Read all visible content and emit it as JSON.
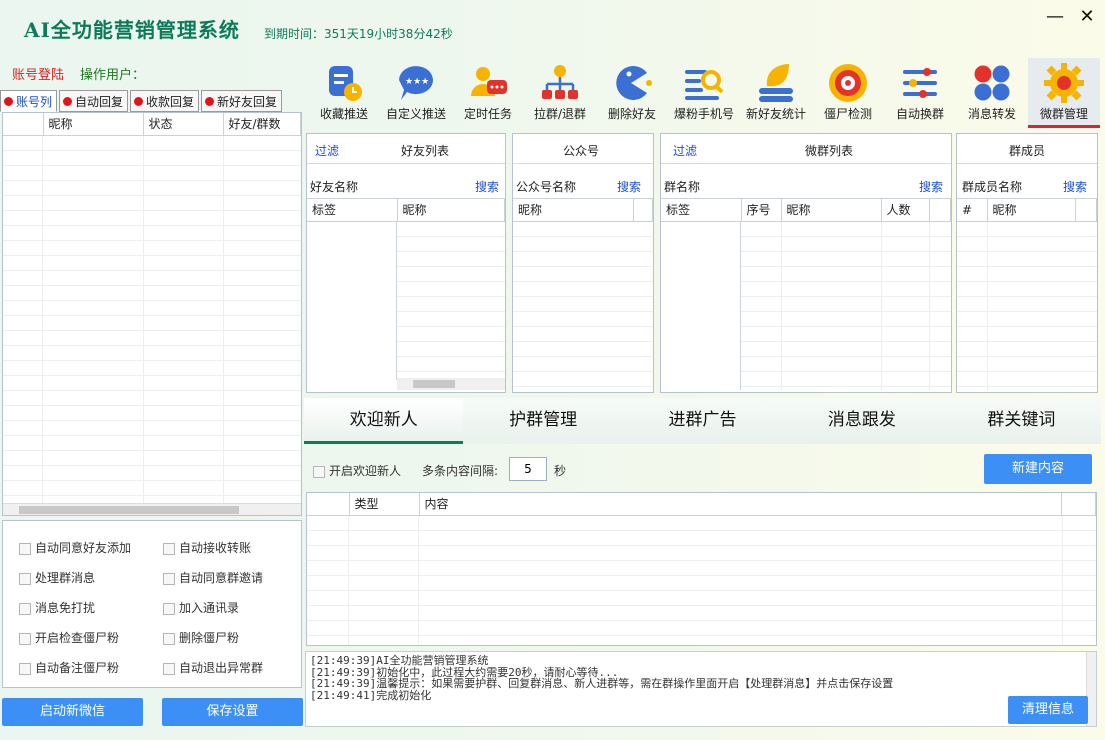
{
  "title": "AI全功能营销管理系统",
  "expiry": "到期时间：351天19小时38分42秒",
  "window": {
    "minimize": "—",
    "close": "✕"
  },
  "status": {
    "login": "账号登陆",
    "operator": "操作用户："
  },
  "toolbar": [
    {
      "label": "收藏推送",
      "icon": "bookmark-clock-icon"
    },
    {
      "label": "自定义推送",
      "icon": "chat-bubble-stars-icon"
    },
    {
      "label": "定时任务",
      "icon": "user-chat-icon"
    },
    {
      "label": "拉群/退群",
      "icon": "org-tree-icon"
    },
    {
      "label": "删除好友",
      "icon": "pacman-icon"
    },
    {
      "label": "爆粉手机号",
      "icon": "list-search-icon"
    },
    {
      "label": "新好友统计",
      "icon": "leaf-stack-icon"
    },
    {
      "label": "僵尸检测",
      "icon": "target-icon"
    },
    {
      "label": "自动换群",
      "icon": "sliders-icon"
    },
    {
      "label": "消息转发",
      "icon": "dots-grid-icon"
    },
    {
      "label": "微群管理",
      "icon": "gear-icon",
      "active": true
    }
  ],
  "left_tabs": [
    "账号列",
    "自动回复",
    "收款回复",
    "新好友回复"
  ],
  "account_table": {
    "headers": [
      "",
      "昵称",
      "状态",
      "好友/群数"
    ]
  },
  "options": [
    [
      "自动同意好友添加",
      "自动接收转账"
    ],
    [
      "处理群消息",
      "自动同意群邀请"
    ],
    [
      "消息免打扰",
      "加入通讯录"
    ],
    [
      "开启检查僵尸粉",
      "删除僵尸粉"
    ],
    [
      "自动备注僵尸粉",
      "自动退出异常群"
    ]
  ],
  "left_buttons": {
    "start": "启动新微信",
    "save": "保存设置"
  },
  "panels": {
    "friends": {
      "filter": "过滤",
      "title": "好友列表",
      "search_label": "好友名称",
      "search_btn": "搜索",
      "cols": [
        "标签",
        "昵称"
      ]
    },
    "official": {
      "title": "公众号",
      "search_label": "公众号名称",
      "search_btn": "搜索",
      "cols": [
        "昵称"
      ]
    },
    "groups": {
      "filter": "过滤",
      "title": "微群列表",
      "search_label": "群名称",
      "search_btn": "搜索",
      "cols": [
        "标签",
        "序号",
        "昵称",
        "人数"
      ]
    },
    "members": {
      "title": "群成员",
      "search_label": "群成员名称",
      "search_btn": "搜索",
      "cols": [
        "#",
        "昵称"
      ]
    }
  },
  "main_tabs": [
    "欢迎新人",
    "护群管理",
    "进群广告",
    "消息跟发",
    "群关键词"
  ],
  "welcome": {
    "enable": "开启欢迎新人",
    "interval_label": "多条内容间隔:",
    "interval_value": "5",
    "unit": "秒",
    "new_btn": "新建内容",
    "cols": [
      "类型",
      "内容"
    ]
  },
  "log": [
    "[21:49:39]AI全功能营销管理系统",
    "[21:49:39]初始化中，此过程大约需要20秒，请耐心等待...",
    "[21:49:39]温馨提示：如果需要护群、回复群消息、新人进群等，需在群操作里面开启【处理群消息】并点击保存设置",
    "[21:49:41]完成初始化"
  ],
  "clear_btn": "清理信息",
  "colors": {
    "accent": "#3b8ff5",
    "brand": "#0d7a5a",
    "alert": "#e0201f"
  }
}
